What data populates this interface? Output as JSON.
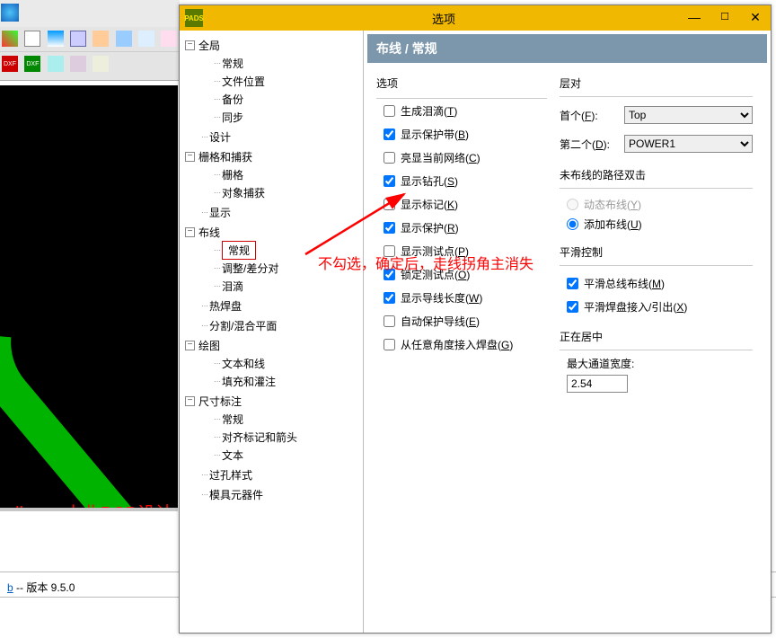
{
  "bg": {
    "version_prefix": "b",
    "version_label": " -- 版本  9.5.0",
    "watermark": "allegro 小北PCB设计"
  },
  "annotation": {
    "text": "不勾选，确定后，走线拐角主消失"
  },
  "dialog": {
    "icon_text": "PADS",
    "title": "选项",
    "breadcrumb": "布线 / 常规"
  },
  "tree": {
    "n0": "全局",
    "n0_0": "常规",
    "n0_1": "文件位置",
    "n0_2": "备份",
    "n0_3": "同步",
    "n1": "设计",
    "n2": "栅格和捕获",
    "n2_0": "栅格",
    "n2_1": "对象捕获",
    "n3": "显示",
    "n4": "布线",
    "n4_0": "常规",
    "n4_1": "调整/差分对",
    "n4_2": "泪滴",
    "n5": "热焊盘",
    "n6": "分割/混合平面",
    "n7": "绘图",
    "n7_0": "文本和线",
    "n7_1": "填充和灌注",
    "n8": "尺寸标注",
    "n8_0": "常规",
    "n8_1": "对齐标记和箭头",
    "n8_2": "文本",
    "n9": "过孔样式",
    "n10": "模具元器件"
  },
  "opts": {
    "group_title": "选项",
    "c0": {
      "label": "生成泪滴(",
      "key": "T",
      "suffix": ")",
      "checked": false
    },
    "c1": {
      "label": "显示保护带(",
      "key": "B",
      "suffix": ")",
      "checked": true
    },
    "c2": {
      "label": "亮显当前网络(",
      "key": "C",
      "suffix": ")",
      "checked": false
    },
    "c3": {
      "label": "显示钻孔(",
      "key": "S",
      "suffix": ")",
      "checked": true
    },
    "c4": {
      "label": "显示标记(",
      "key": "K",
      "suffix": ")",
      "checked": false
    },
    "c5": {
      "label": "显示保护(",
      "key": "R",
      "suffix": ")",
      "checked": true
    },
    "c6": {
      "label": "显示测试点(",
      "key": "P",
      "suffix": ")",
      "checked": false
    },
    "c7": {
      "label": "锁定测试点(",
      "key": "O",
      "suffix": ")",
      "checked": true
    },
    "c8": {
      "label": "显示导线长度(",
      "key": "W",
      "suffix": ")",
      "checked": true
    },
    "c9": {
      "label": "自动保护导线(",
      "key": "E",
      "suffix": ")",
      "checked": false
    },
    "c10": {
      "label": "从任意角度接入焊盘(",
      "key": "G",
      "suffix": ")",
      "checked": false
    }
  },
  "layerpair": {
    "title": "层对",
    "first_label": "首个(",
    "first_key": "F",
    "first_suffix": "):",
    "first_value": "Top",
    "second_label": "第二个(",
    "second_key": "D",
    "second_suffix": "):",
    "second_value": "POWER1"
  },
  "unrouted": {
    "title": "未布线的路径双击",
    "r0": {
      "label": "动态布线(",
      "key": "Y",
      "suffix": ")"
    },
    "r1": {
      "label": "添加布线(",
      "key": "U",
      "suffix": ")"
    }
  },
  "smooth": {
    "title": "平滑控制",
    "c0": {
      "label": "平滑总线布线(",
      "key": "M",
      "suffix": ")",
      "checked": true
    },
    "c1": {
      "label": "平滑焊盘接入/引出(",
      "key": "X",
      "suffix": ")",
      "checked": true
    }
  },
  "shoving": {
    "title": "正在居中",
    "label": "最大通道宽度:",
    "value": "2.54"
  }
}
